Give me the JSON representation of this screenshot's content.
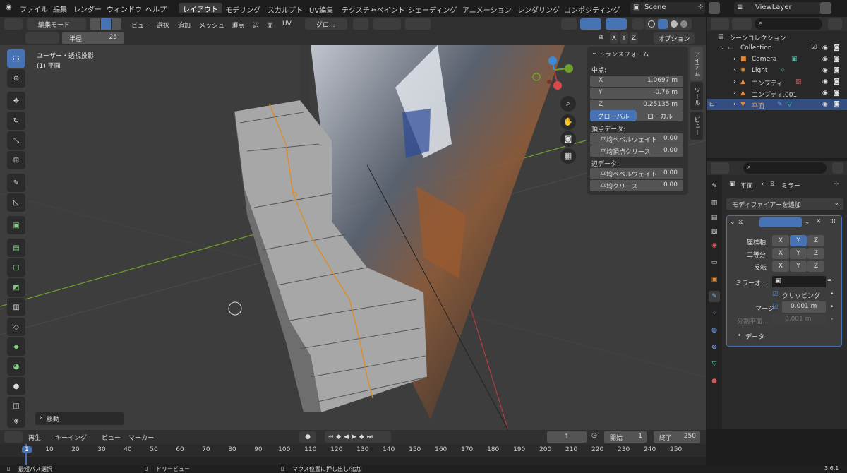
{
  "topmenu": {
    "items": [
      "ファイル",
      "編集",
      "レンダー",
      "ウィンドウ",
      "ヘルプ"
    ]
  },
  "workspaces": [
    "レイアウト",
    "モデリング",
    "スカルプト",
    "UV編集",
    "テクスチャペイント",
    "シェーディング",
    "アニメーション",
    "レンダリング",
    "コンポジティング"
  ],
  "scene": "Scene",
  "viewlayer": "ViewLayer",
  "viewport_header": {
    "mode": "編集モード",
    "menus": [
      "ビュー",
      "選択",
      "追加",
      "メッシュ",
      "頂点",
      "辺",
      "面",
      "UV"
    ],
    "orientation": "グロ...",
    "options": "オプション",
    "axes": [
      "X",
      "Y",
      "Z"
    ]
  },
  "subheader": {
    "radius_label": "半径",
    "radius_value": "25"
  },
  "overlay": {
    "view_name": "ユーザー・透視投影",
    "object": "(1) 平面"
  },
  "last_op": "移動",
  "npanel": {
    "title": "トランスフォーム",
    "median": "中点:",
    "x_label": "X",
    "x": "1.0697 m",
    "y_label": "Y",
    "y": "-0.76 m",
    "z_label": "Z",
    "z": "0.25135 m",
    "global": "グローバル",
    "local": "ローカル",
    "vertex_data": "頂点データ:",
    "mean_bevel_w": "平均ベベルウェイト",
    "mean_bevel_w_val": "0.00",
    "mean_vert_crease": "平均頂点クリース",
    "mean_vert_crease_val": "0.00",
    "edge_data": "辺データ:",
    "edge_bevel_w": "平均ベベルウェイト",
    "edge_bevel_w_val": "0.00",
    "edge_crease": "平均クリース",
    "edge_crease_val": "0.00"
  },
  "sidetabs": [
    "アイテム",
    "ツール",
    "ビュー"
  ],
  "outliner": {
    "root": "シーンコレクション",
    "collection": "Collection",
    "items": [
      "Camera",
      "Light",
      "エンプティ",
      "エンプティ.001",
      "平面"
    ]
  },
  "properties": {
    "object": "平面",
    "modifier": "ミラー",
    "add_modifier": "モディファイアーを追加",
    "axis_label": "座標軸",
    "bisect_label": "二等分",
    "flip_label": "反転",
    "x": "X",
    "y": "Y",
    "z": "Z",
    "mirror_obj": "ミラーオ...",
    "clipping": "クリッピング",
    "merge": "マージ",
    "merge_val": "0.001 m",
    "bisect_dist": "分割平面...",
    "bisect_dist_val": "0.001 m",
    "data": "データ"
  },
  "timeline": {
    "menus": [
      "再生",
      "キーイング",
      "ビュー",
      "マーカー"
    ],
    "current": "1",
    "start_label": "開始",
    "start": "1",
    "end_label": "終了",
    "end": "250",
    "ticks": [
      "1",
      "10",
      "20",
      "30",
      "40",
      "50",
      "60",
      "70",
      "80",
      "90",
      "100",
      "110",
      "120",
      "130",
      "140",
      "150",
      "160",
      "170",
      "180",
      "190",
      "200",
      "210",
      "220",
      "230",
      "240",
      "250"
    ]
  },
  "status": {
    "left": "最短パス選択",
    "middle": "ドリービュー",
    "right": "マウス位置に押し出し/追加",
    "version": "3.6.1"
  }
}
